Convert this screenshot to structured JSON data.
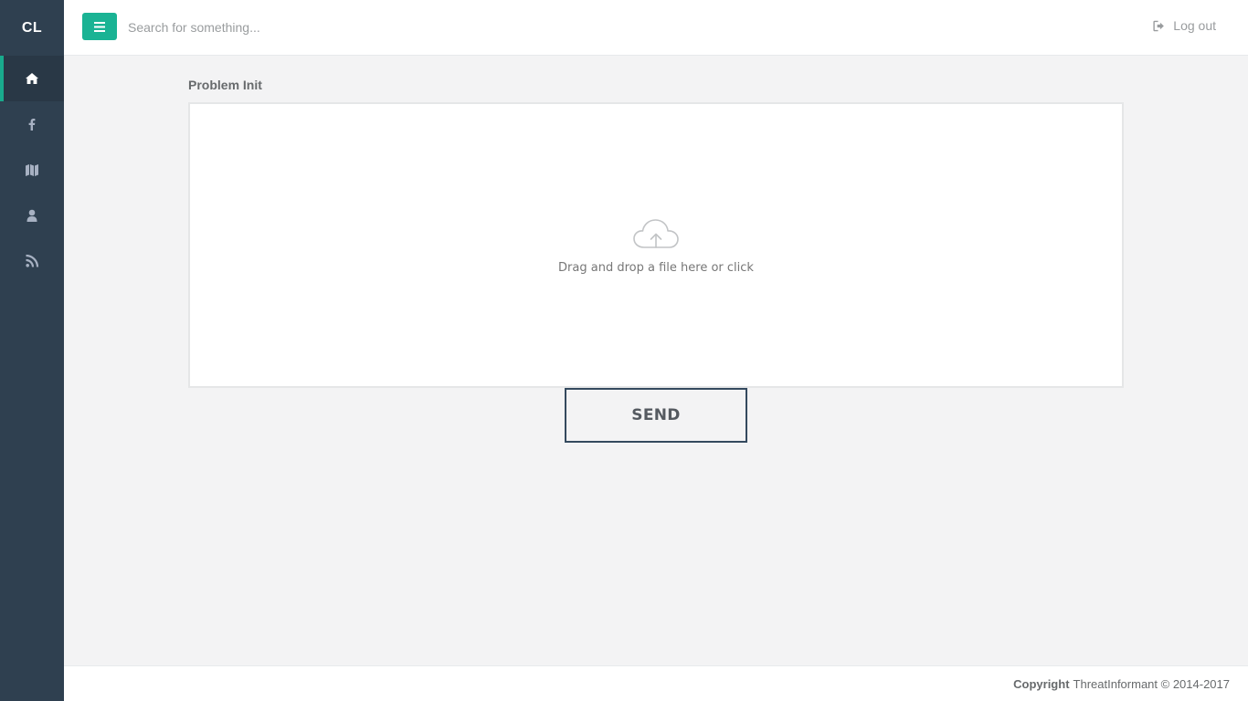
{
  "sidebar": {
    "brand": "CL",
    "items": [
      {
        "icon": "home-icon",
        "active": true
      },
      {
        "icon": "facebook-icon",
        "active": false
      },
      {
        "icon": "map-icon",
        "active": false
      },
      {
        "icon": "user-icon",
        "active": false
      },
      {
        "icon": "rss-icon",
        "active": false
      }
    ]
  },
  "topbar": {
    "menu_icon": "bars-icon",
    "search_placeholder": "Search for something...",
    "search_value": "",
    "logout_label": "Log out",
    "logout_icon": "sign-out-icon"
  },
  "main": {
    "section_label": "Problem Init",
    "dropzone": {
      "icon": "cloud-upload-icon",
      "text": "Drag and drop a file here or click"
    },
    "send_label": "SEND"
  },
  "footer": {
    "copyright_label": "Copyright",
    "copyright_text": "ThreatInformant © 2014-2017"
  },
  "colors": {
    "sidebar_bg": "#2f4050",
    "accent": "#1ab394",
    "page_bg": "#f3f3f4"
  }
}
